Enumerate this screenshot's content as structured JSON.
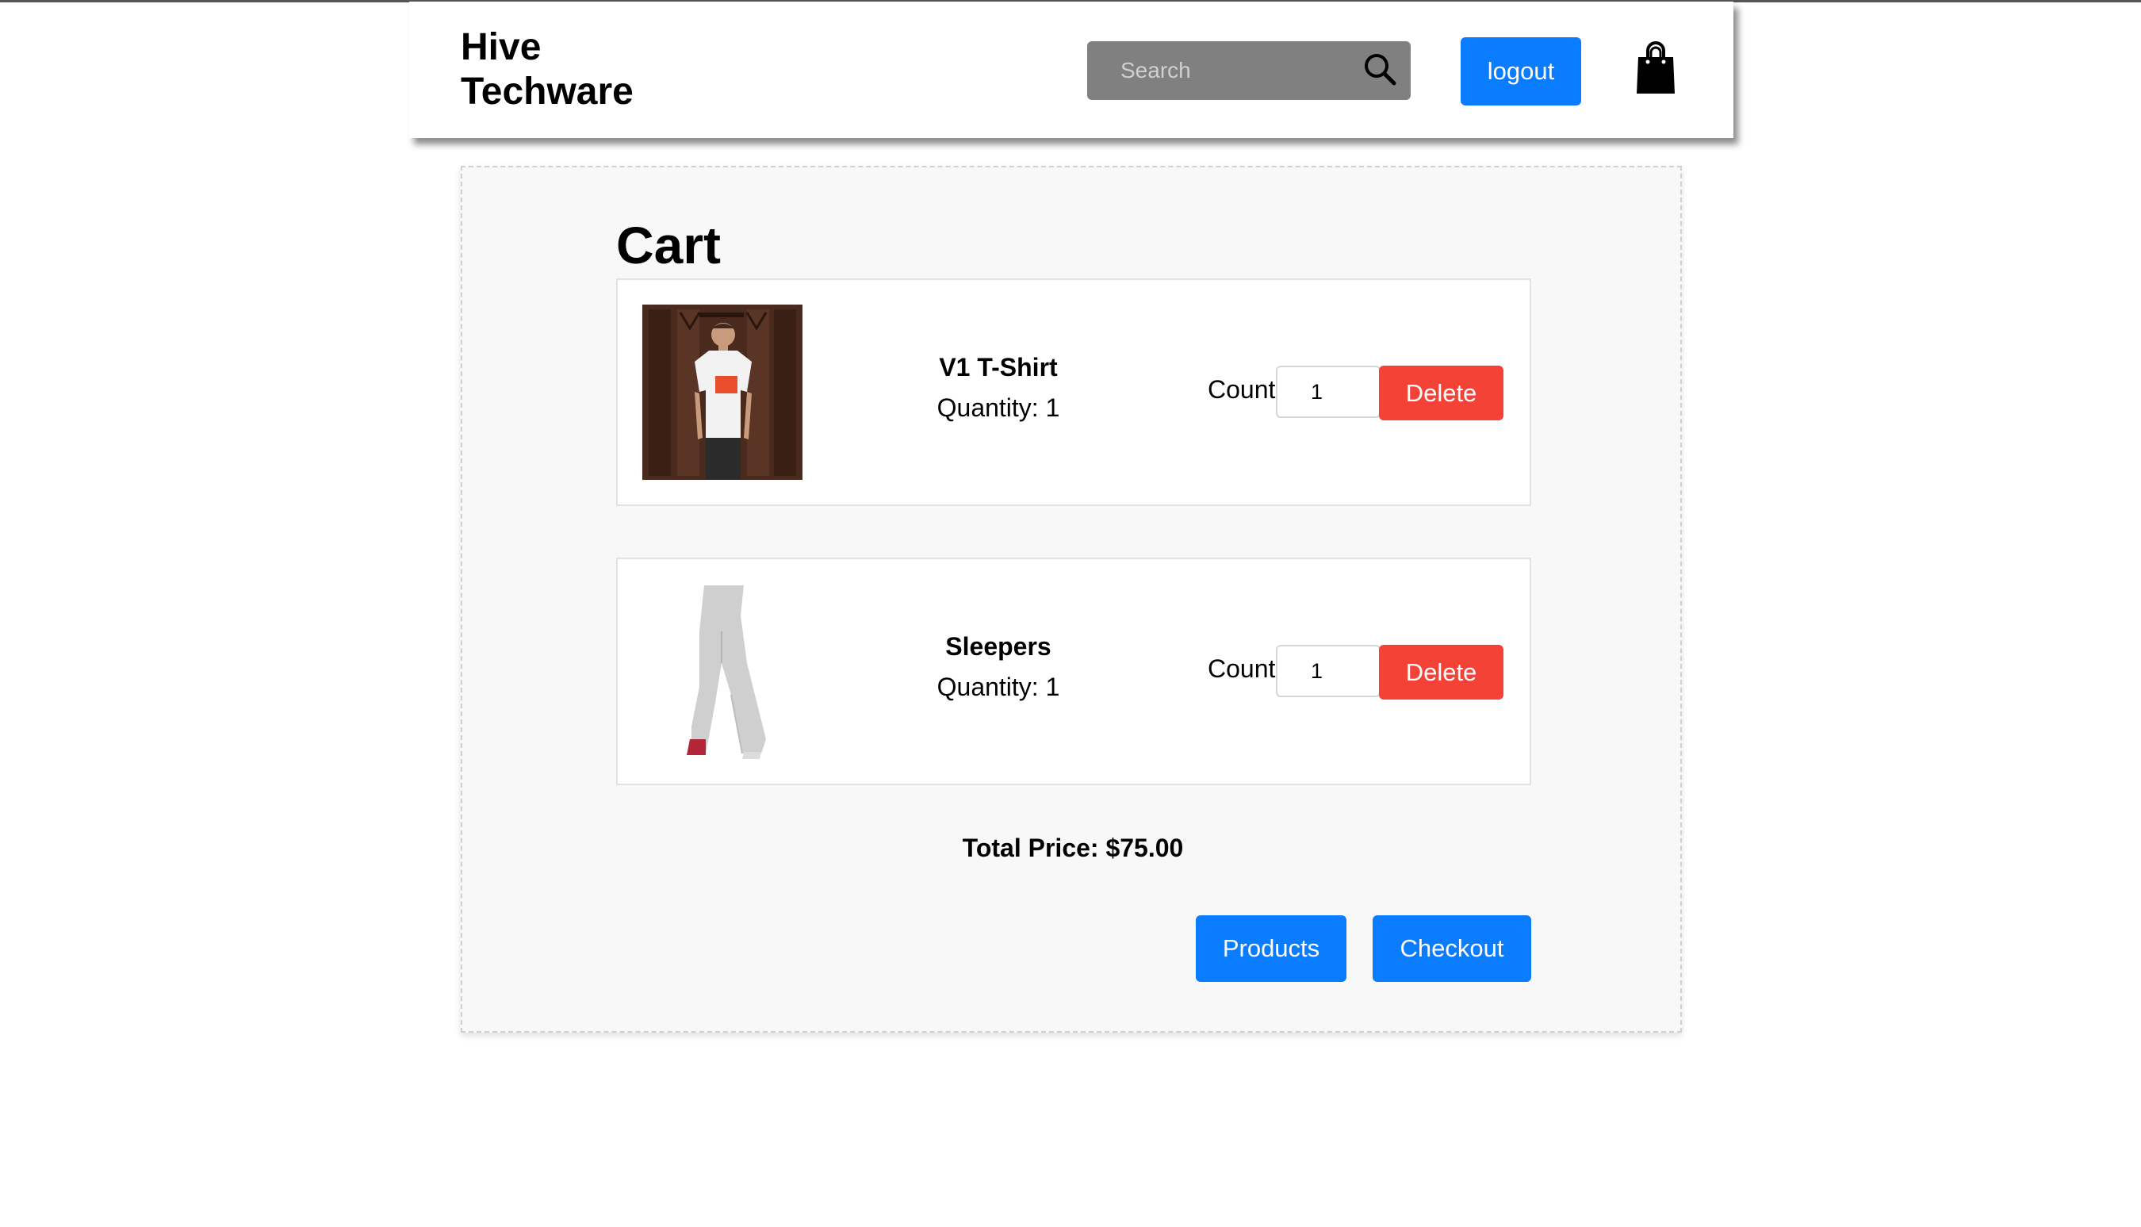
{
  "header": {
    "brand": "Hive Techware",
    "search_placeholder": "Search",
    "logout_label": "logout",
    "icons": {
      "search": "search-icon",
      "cart": "shopping-bag-icon"
    }
  },
  "cart": {
    "title": "Cart",
    "items": [
      {
        "name": "V1 T-Shirt",
        "quantity_text": "Quantity: 1",
        "count_label": "Count",
        "count_value": "1",
        "delete_label": "Delete",
        "image": "man-wearing-white-tshirt-photo"
      },
      {
        "name": "Sleepers",
        "quantity_text": "Quantity: 1",
        "count_label": "Count",
        "count_value": "1",
        "delete_label": "Delete",
        "image": "grey-sweatpants-photo"
      }
    ],
    "total_text": "Total Price: $75.00",
    "products_label": "Products",
    "checkout_label": "Checkout"
  },
  "colors": {
    "primary": "#0a7cff",
    "danger": "#f44336",
    "search_bg": "#808080",
    "panel_bg": "#f8f8f8"
  }
}
